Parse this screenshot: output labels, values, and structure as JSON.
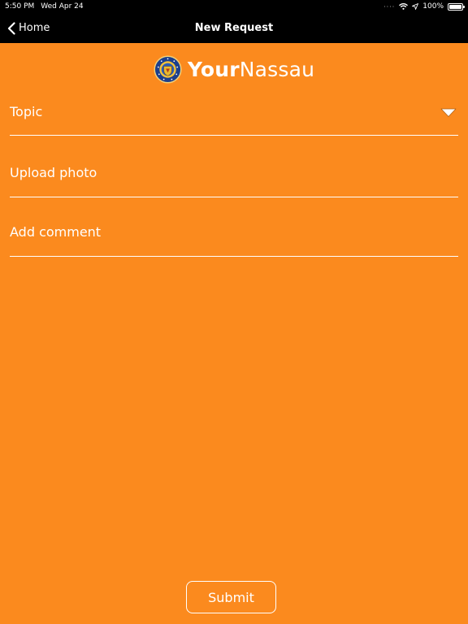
{
  "status_bar": {
    "time": "5:50 PM",
    "date": "Wed Apr 24",
    "battery": "100%"
  },
  "nav": {
    "back_label": "Home",
    "title": "New Request"
  },
  "logo": {
    "text_strong": "Your",
    "text_light": "Nassau"
  },
  "form": {
    "topic_placeholder": "Topic",
    "photo_placeholder": "Upload photo",
    "comment_placeholder": "Add comment",
    "submit_label": "Submit"
  },
  "icons": [
    "wifi-icon",
    "location-arrow-icon",
    "battery-icon",
    "chevron-left-icon",
    "dropdown-triangle-icon",
    "county-seal-icon"
  ],
  "colors": {
    "background": "#fb8a1e",
    "bar": "#000000",
    "text": "#ffffff"
  }
}
